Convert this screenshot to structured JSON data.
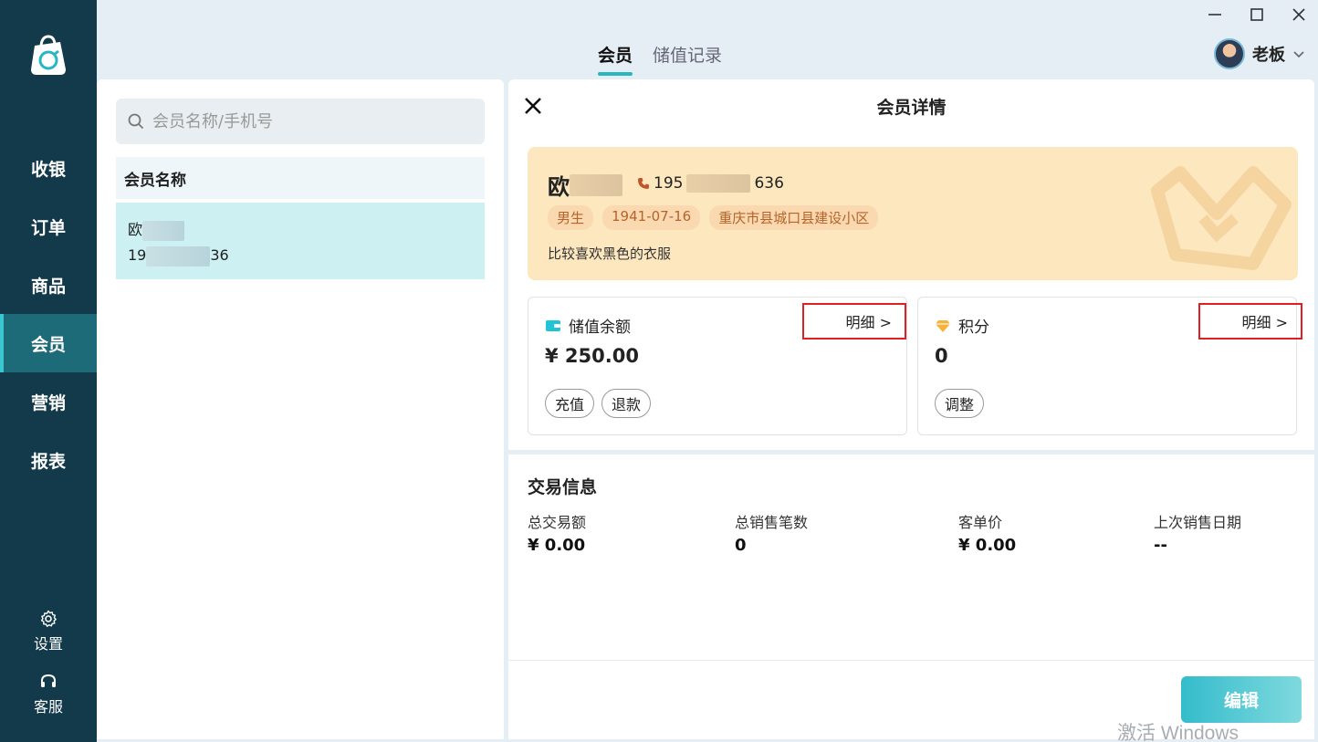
{
  "sidebar": {
    "items": [
      {
        "label": "收银"
      },
      {
        "label": "订单"
      },
      {
        "label": "商品"
      },
      {
        "label": "会员",
        "active": true
      },
      {
        "label": "营销"
      },
      {
        "label": "报表"
      }
    ],
    "settings_label": "设置",
    "support_label": "客服"
  },
  "header": {
    "tabs": [
      {
        "label": "会员",
        "active": true
      },
      {
        "label": "储值记录"
      }
    ],
    "user_name": "老板"
  },
  "search": {
    "placeholder": "会员名称/手机号"
  },
  "member_list": {
    "column_header": "会员名称",
    "rows": [
      {
        "name_prefix": "欧",
        "phone_prefix": "19",
        "phone_suffix": "36"
      }
    ]
  },
  "detail": {
    "title": "会员详情",
    "name_prefix": "欧",
    "phone_prefix": "195",
    "phone_suffix": "636",
    "tags": [
      "男生",
      "1941-07-16",
      "重庆市县城口县建设小区"
    ],
    "note": "比较喜欢黑色的衣服",
    "stored_value": {
      "label": "储值余额",
      "detail_link": "明细 >",
      "value": "¥ 250.00",
      "recharge_label": "充值",
      "refund_label": "退款"
    },
    "points": {
      "label": "积分",
      "detail_link": "明细 >",
      "value": "0",
      "adjust_label": "调整"
    },
    "transactions": {
      "title": "交易信息",
      "items": [
        {
          "label": "总交易额",
          "value": "¥ 0.00"
        },
        {
          "label": "总销售笔数",
          "value": "0"
        },
        {
          "label": "客单价",
          "value": "¥ 0.00"
        },
        {
          "label": "上次销售日期",
          "value": "--"
        }
      ]
    },
    "edit_label": "编辑"
  },
  "activation_text": "激活 Windows",
  "colors": {
    "sidebar_bg": "#123a4a",
    "accent": "#28b6c4",
    "profile_bg": "#fde7bf",
    "highlight_border": "#e02020"
  }
}
